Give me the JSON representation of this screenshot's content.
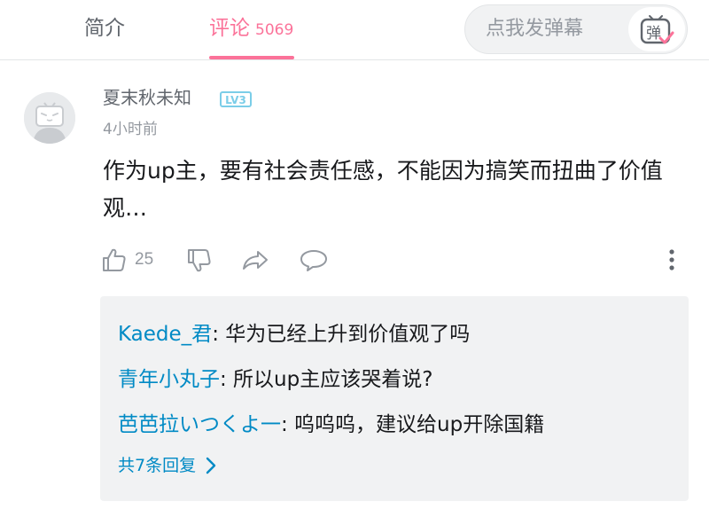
{
  "tabs": {
    "intro_label": "简介",
    "comments_label": "评论",
    "comments_count": "5069"
  },
  "danmaku": {
    "placeholder": "点我发弹幕",
    "button_glyph": "弹"
  },
  "comment": {
    "username": "夏末秋未知",
    "level": "LV3",
    "timestamp": "4小时前",
    "text": "作为up主，要有社会责任感，不能因为搞笑而扭曲了价值观…",
    "like_count": "25"
  },
  "replies": [
    {
      "name": "Kaede_君",
      "text": ": 华为已经上升到价值观了吗"
    },
    {
      "name": "青年小丸子",
      "text": ": 所以up主应该哭着说?"
    },
    {
      "name": "芭芭拉いつくよ一",
      "text": ": 呜呜呜，建议给up开除国籍"
    }
  ],
  "view_all_label": "共7条回复",
  "icons": {
    "like": "thumbs-up-icon",
    "dislike": "thumbs-down-icon",
    "share": "share-arrow-icon",
    "reply": "speech-bubble-icon",
    "more": "vertical-ellipsis-icon",
    "danmaku": "tv-danmaku-icon"
  },
  "colors": {
    "accent": "#fb7299",
    "link": "#008ac5",
    "level_badge": "#7bcde8",
    "secondary_text": "#9499a0"
  }
}
